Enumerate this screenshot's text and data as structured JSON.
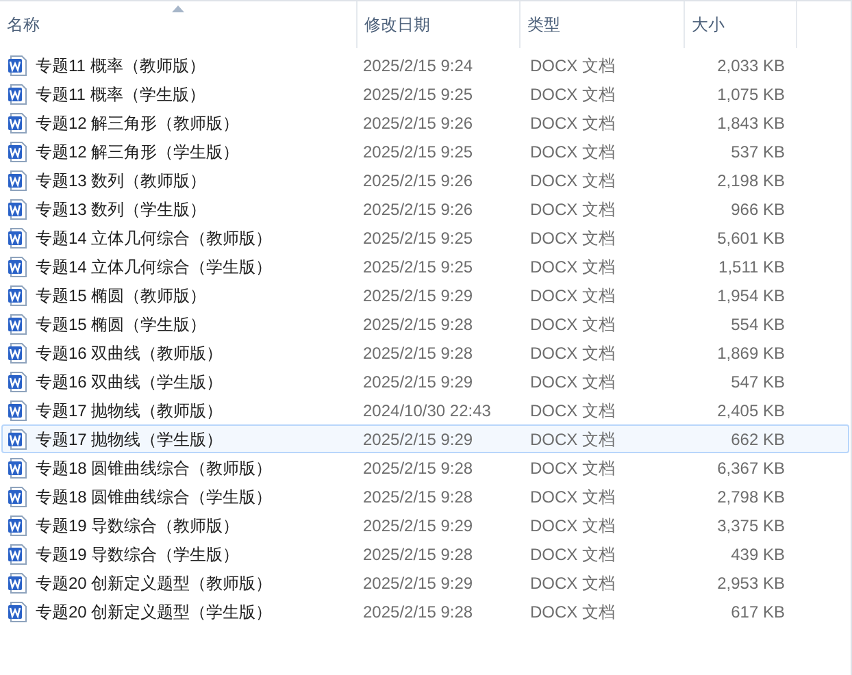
{
  "columns": [
    {
      "label": "名称",
      "sorted": true
    },
    {
      "label": "修改日期",
      "sorted": false
    },
    {
      "label": "类型",
      "sorted": false
    },
    {
      "label": "大小",
      "sorted": false
    }
  ],
  "rows": [
    {
      "name": "专题11 概率（教师版）",
      "date": "2025/2/15 9:24",
      "type": "DOCX 文档",
      "size": "2,033 KB",
      "hovered": false
    },
    {
      "name": "专题11 概率（学生版）",
      "date": "2025/2/15 9:25",
      "type": "DOCX 文档",
      "size": "1,075 KB",
      "hovered": false
    },
    {
      "name": "专题12 解三角形（教师版）",
      "date": "2025/2/15 9:26",
      "type": "DOCX 文档",
      "size": "1,843 KB",
      "hovered": false
    },
    {
      "name": "专题12 解三角形（学生版）",
      "date": "2025/2/15 9:25",
      "type": "DOCX 文档",
      "size": "537 KB",
      "hovered": false
    },
    {
      "name": "专题13 数列（教师版）",
      "date": "2025/2/15 9:26",
      "type": "DOCX 文档",
      "size": "2,198 KB",
      "hovered": false
    },
    {
      "name": "专题13 数列（学生版）",
      "date": "2025/2/15 9:26",
      "type": "DOCX 文档",
      "size": "966 KB",
      "hovered": false
    },
    {
      "name": "专题14 立体几何综合（教师版）",
      "date": "2025/2/15 9:25",
      "type": "DOCX 文档",
      "size": "5,601 KB",
      "hovered": false
    },
    {
      "name": "专题14 立体几何综合（学生版）",
      "date": "2025/2/15 9:25",
      "type": "DOCX 文档",
      "size": "1,511 KB",
      "hovered": false
    },
    {
      "name": "专题15 椭圆（教师版）",
      "date": "2025/2/15 9:29",
      "type": "DOCX 文档",
      "size": "1,954 KB",
      "hovered": false
    },
    {
      "name": "专题15 椭圆（学生版）",
      "date": "2025/2/15 9:28",
      "type": "DOCX 文档",
      "size": "554 KB",
      "hovered": false
    },
    {
      "name": "专题16 双曲线（教师版）",
      "date": "2025/2/15 9:28",
      "type": "DOCX 文档",
      "size": "1,869 KB",
      "hovered": false
    },
    {
      "name": "专题16 双曲线（学生版）",
      "date": "2025/2/15 9:29",
      "type": "DOCX 文档",
      "size": "547 KB",
      "hovered": false
    },
    {
      "name": "专题17 抛物线（教师版）",
      "date": "2024/10/30 22:43",
      "type": "DOCX 文档",
      "size": "2,405 KB",
      "hovered": false
    },
    {
      "name": "专题17 抛物线（学生版）",
      "date": "2025/2/15 9:29",
      "type": "DOCX 文档",
      "size": "662 KB",
      "hovered": true
    },
    {
      "name": "专题18 圆锥曲线综合（教师版）",
      "date": "2025/2/15 9:28",
      "type": "DOCX 文档",
      "size": "6,367 KB",
      "hovered": false
    },
    {
      "name": "专题18 圆锥曲线综合（学生版）",
      "date": "2025/2/15 9:28",
      "type": "DOCX 文档",
      "size": "2,798 KB",
      "hovered": false
    },
    {
      "name": "专题19 导数综合（教师版）",
      "date": "2025/2/15 9:29",
      "type": "DOCX 文档",
      "size": "3,375 KB",
      "hovered": false
    },
    {
      "name": "专题19 导数综合（学生版）",
      "date": "2025/2/15 9:28",
      "type": "DOCX 文档",
      "size": "439 KB",
      "hovered": false
    },
    {
      "name": "专题20 创新定义题型（教师版）",
      "date": "2025/2/15 9:29",
      "type": "DOCX 文档",
      "size": "2,953 KB",
      "hovered": false
    },
    {
      "name": "专题20 创新定义题型（学生版）",
      "date": "2025/2/15 9:28",
      "type": "DOCX 文档",
      "size": "617 KB",
      "hovered": false
    }
  ]
}
